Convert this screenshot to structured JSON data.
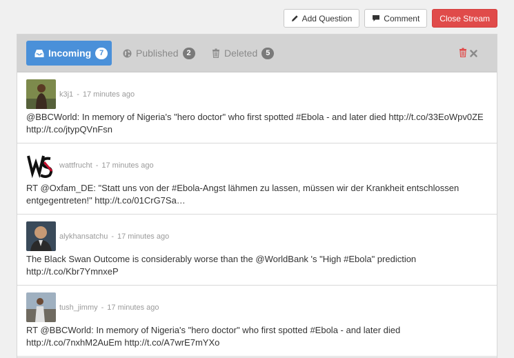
{
  "toolbar": {
    "add_question": "Add Question",
    "comment": "Comment",
    "close_stream": "Close Stream"
  },
  "tabs": [
    {
      "label": "Incoming",
      "count": "7",
      "icon": "inbox-icon",
      "active": true
    },
    {
      "label": "Published",
      "count": "2",
      "icon": "globe-icon",
      "active": false
    },
    {
      "label": "Deleted",
      "count": "5",
      "icon": "trash-icon",
      "active": false
    }
  ],
  "tools": [
    "trash-icon",
    "close-icon"
  ],
  "colors": {
    "accent": "#4a90d9",
    "danger": "#e04b4a",
    "tabbar": "#d3d3d3",
    "background": "#f0f0f0"
  },
  "separator": "-",
  "feed": [
    {
      "author": "k3j1",
      "time": "17 minutes ago",
      "text": "@BBCWorld: In memory of Nigeria's \"hero doctor\" who first spotted #Ebola - and later died http://t.co/33EoWpv0ZE http://t.co/jtypQVnFsn"
    },
    {
      "author": "wattfrucht",
      "time": "17 minutes ago",
      "text": "RT @Oxfam_DE: \"Statt uns von der #Ebola-Angst lähmen zu lassen, müssen wir der Krankheit entschlossen entgegentreten!\" http://t.co/01CrG7Sa…"
    },
    {
      "author": "alykhansatchu",
      "time": "17 minutes ago",
      "text": "The Black Swan Outcome is considerably worse than the @WorldBank 's \"High #Ebola\" prediction http://t.co/Kbr7YmnxeP"
    },
    {
      "author": "tush_jimmy",
      "time": "17 minutes ago",
      "text": "RT @BBCWorld: In memory of Nigeria's \"hero doctor\" who first spotted #Ebola - and later died http://t.co/7nxhM2AuEm http://t.co/A7wrE7mYXo"
    }
  ]
}
